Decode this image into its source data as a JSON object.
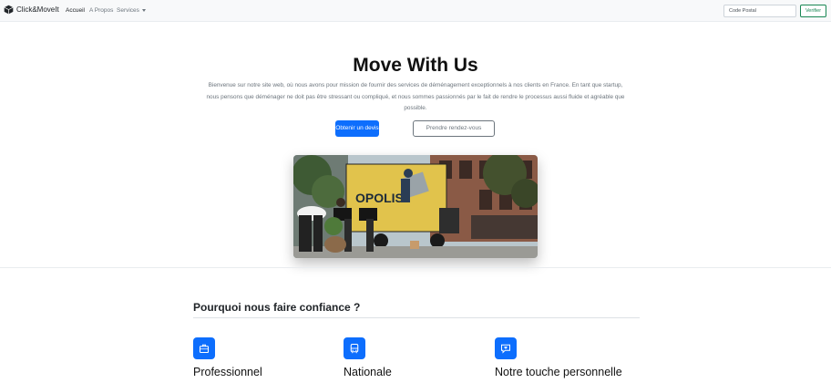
{
  "navbar": {
    "brand": "Click&MoveIt",
    "links": [
      {
        "label": "Accueil",
        "active": true
      },
      {
        "label": "A Propos",
        "active": false
      },
      {
        "label": "Services",
        "active": false,
        "dropdown": true
      }
    ],
    "search_placeholder": "Code Postal",
    "verify_label": "Verifier"
  },
  "hero": {
    "title": "Move With Us",
    "text": "Bienvenue sur notre site web, où nous avons pour mission de fournir des services de déménagement exceptionnels à nos clients en France. En tant que startup, nous pensons que déménager ne doit pas être stressant ou compliqué, et nous sommes passionnés par le fait de rendre le processus aussi fluide et agréable que possible.",
    "primary_button": "Obtenir un devis",
    "secondary_button": "Prendre rendez-vous",
    "truck_text": "OPOLIS"
  },
  "trust": {
    "title": "Pourquoi nous faire confiance ?",
    "features": [
      {
        "title": "Professionnel",
        "icon": "briefcase-icon"
      },
      {
        "title": "Nationale",
        "icon": "bus-icon"
      },
      {
        "title": "Notre touche personnelle",
        "icon": "chat-heart-icon"
      }
    ]
  },
  "colors": {
    "primary": "#0d6efd",
    "success": "#198754",
    "muted": "#6c757d"
  }
}
